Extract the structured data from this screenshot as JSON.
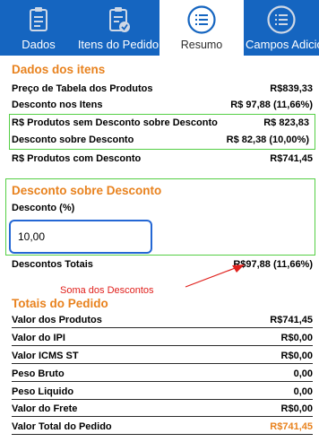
{
  "tabs": [
    {
      "label": "Dados",
      "icon": "clipboard-icon"
    },
    {
      "label": "Itens do Pedido",
      "icon": "clipboard-check-icon"
    },
    {
      "label": "Resumo",
      "icon": "list-circle-icon",
      "active": true
    },
    {
      "label": "Campos Adicio",
      "icon": "list-circle-icon"
    }
  ],
  "dados_itens": {
    "title": "Dados dos itens",
    "rows": [
      {
        "label": "Preço de Tabela dos Produtos",
        "value": "R$839,33"
      },
      {
        "label": "Desconto nos Itens",
        "value": "R$ 97,88 (11,66%)"
      },
      {
        "label": "R$ Produtos sem Desconto sobre Desconto",
        "value": "R$ 823,83"
      },
      {
        "label": "Desconto sobre Desconto",
        "value": "R$ 82,38 (10,00%)"
      },
      {
        "label": "R$ Produtos com Desconto",
        "value": "R$741,45"
      }
    ]
  },
  "desconto_sobre_desconto": {
    "title": "Desconto sobre Desconto",
    "field_label": "Desconto (%)",
    "field_value": "10,00"
  },
  "descontos_totais": {
    "label": "Descontos Totais",
    "value": "R$97,88 (11,66%)"
  },
  "annotation": "Soma dos Descontos",
  "totais": {
    "title": "Totais do Pedido",
    "rows": [
      {
        "label": "Valor dos Produtos",
        "value": "R$741,45"
      },
      {
        "label": "Valor do IPI",
        "value": "R$0,00"
      },
      {
        "label": "Valor ICMS ST",
        "value": "R$0,00"
      },
      {
        "label": "Peso Bruto",
        "value": "0,00"
      },
      {
        "label": "Peso Liquido",
        "value": "0,00"
      },
      {
        "label": "Valor do Frete",
        "value": "R$0,00"
      },
      {
        "label": "Valor Total do Pedido",
        "value": "R$741,45"
      }
    ]
  },
  "colors": {
    "tabbar": "#1565c0",
    "accent_orange": "#e8821e",
    "highlight_green": "#55cf45",
    "input_border": "#2467d4",
    "annotation_red": "#e0201c"
  }
}
